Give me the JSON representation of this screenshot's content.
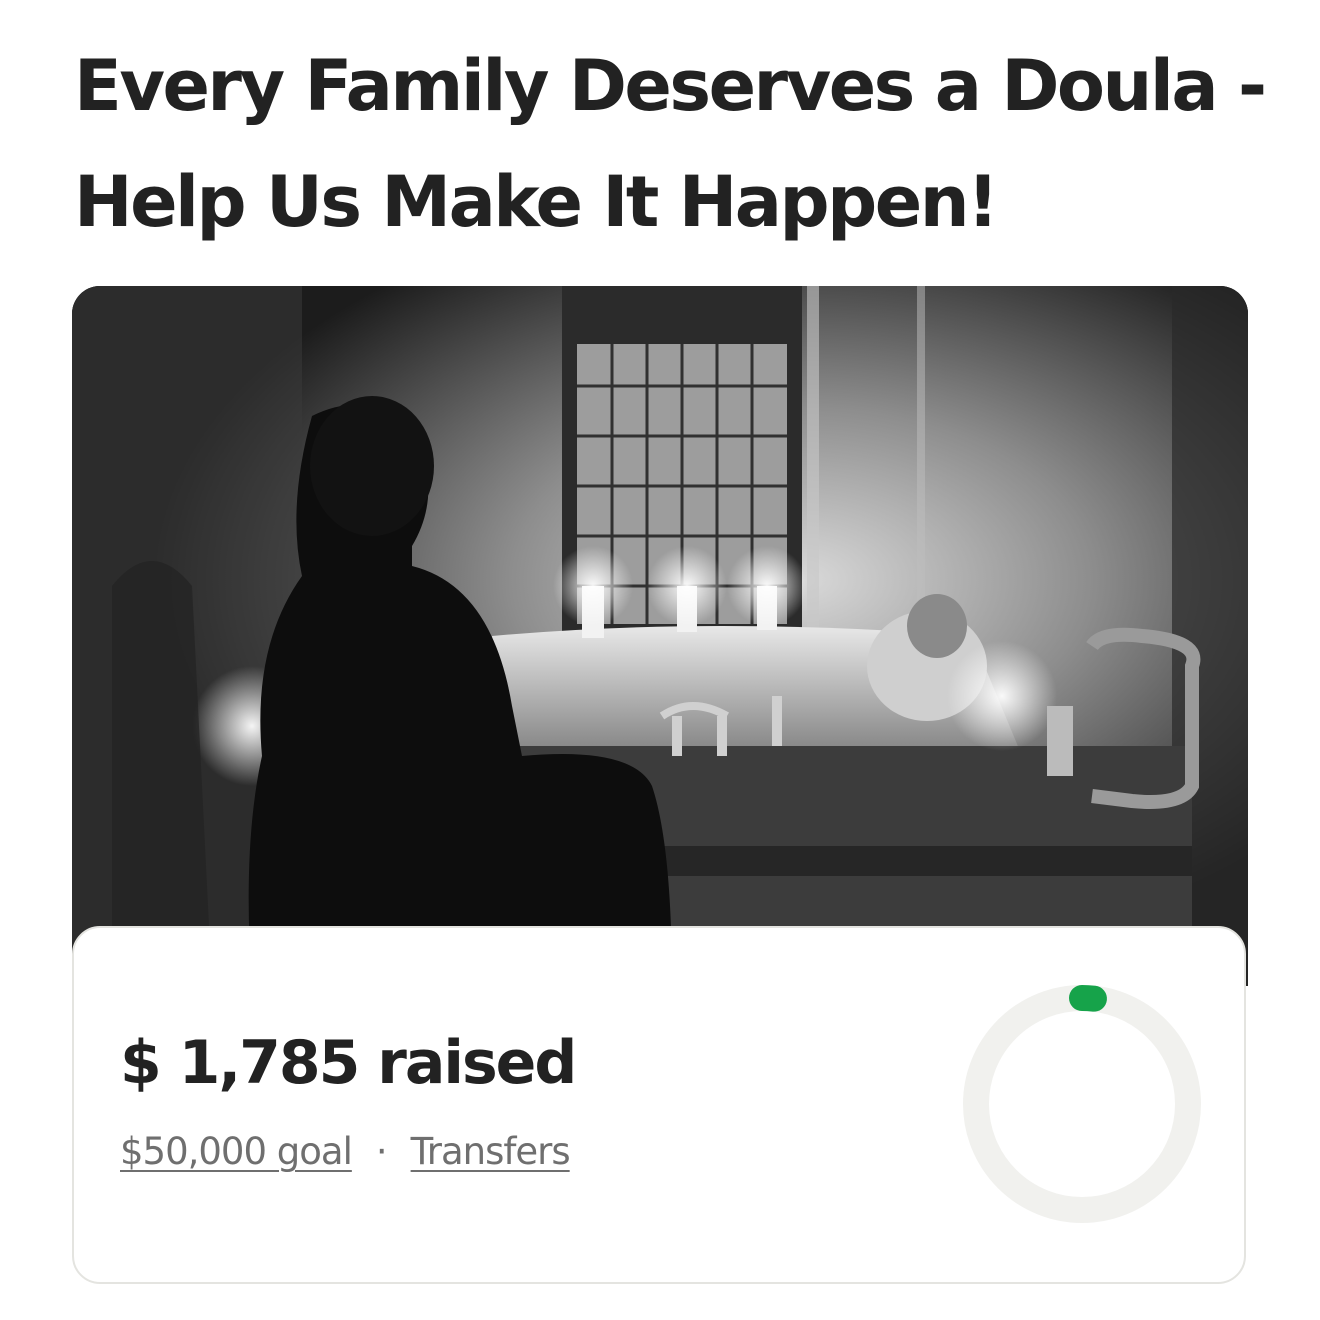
{
  "campaign": {
    "title": "Every Family Deserves a Doula - Help Us Make It Happen!"
  },
  "progress": {
    "raised_text": "$ 1,785 raised",
    "goal_text": "$50,000 goal",
    "separator": "·",
    "transfers_text": "Transfers",
    "fraction": 0.0357
  },
  "colors": {
    "progress_accent": "#16a34a",
    "ring_track": "#f1f1ee",
    "title_text": "#222222",
    "muted_text": "#6f6f6f"
  },
  "icons": {
    "progress": "circular-progress-icon"
  }
}
